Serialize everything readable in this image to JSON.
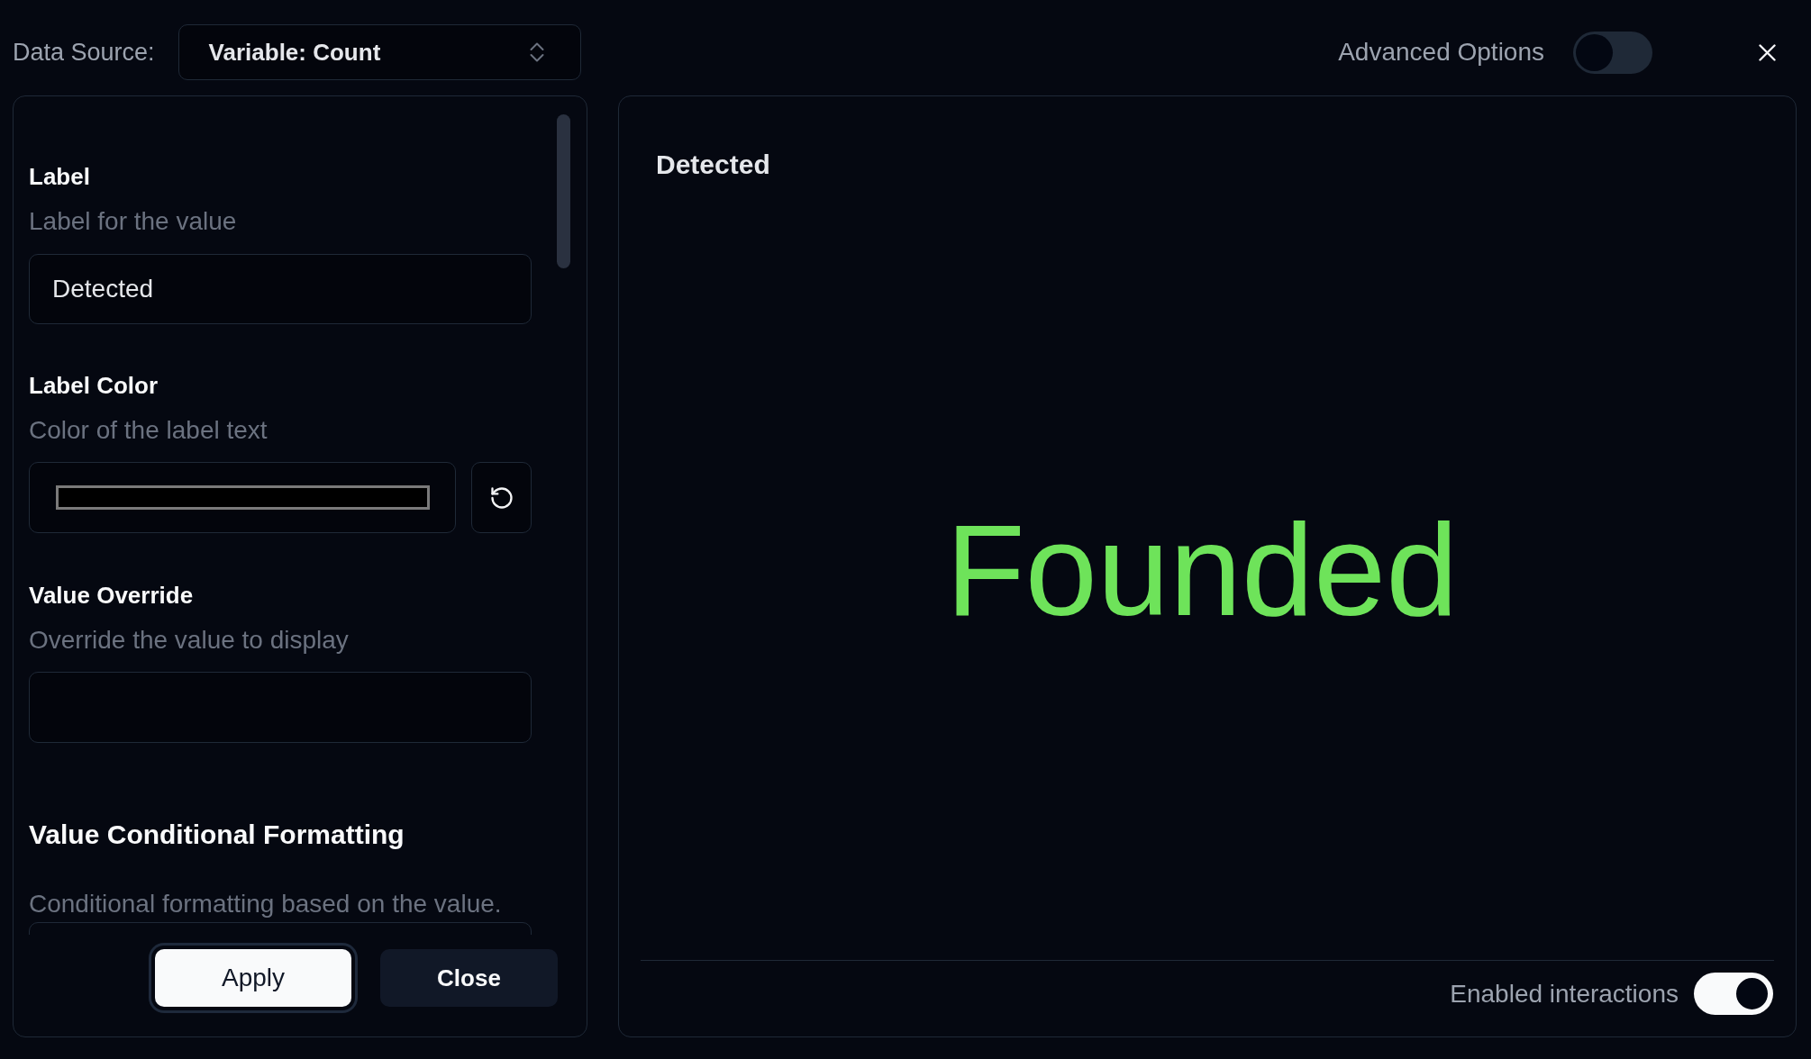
{
  "header": {
    "data_source": {
      "label": "Data Source:",
      "value": "Variable: Count"
    },
    "advanced_options": {
      "label": "Advanced Options",
      "on": false
    }
  },
  "settings": {
    "fields": [
      {
        "kind": "text",
        "label": "Label",
        "description": "Label for the value",
        "value": "Detected"
      },
      {
        "kind": "color",
        "label": "Label Color",
        "description": "Color of the label text",
        "color": "#000000"
      },
      {
        "kind": "text",
        "label": "Value Override",
        "description": "Override the value to display"
      }
    ],
    "section": {
      "title": "Value Conditional Formatting",
      "description": "Conditional formatting based on the value."
    },
    "buttons": [
      {
        "kind": "primary",
        "label": "Apply"
      },
      {
        "kind": "secondary",
        "label": "Close"
      }
    ]
  },
  "preview": {
    "title": "Detected",
    "value": "Founded"
  },
  "footer": {
    "label": "Enabled interactions",
    "on": true
  }
}
